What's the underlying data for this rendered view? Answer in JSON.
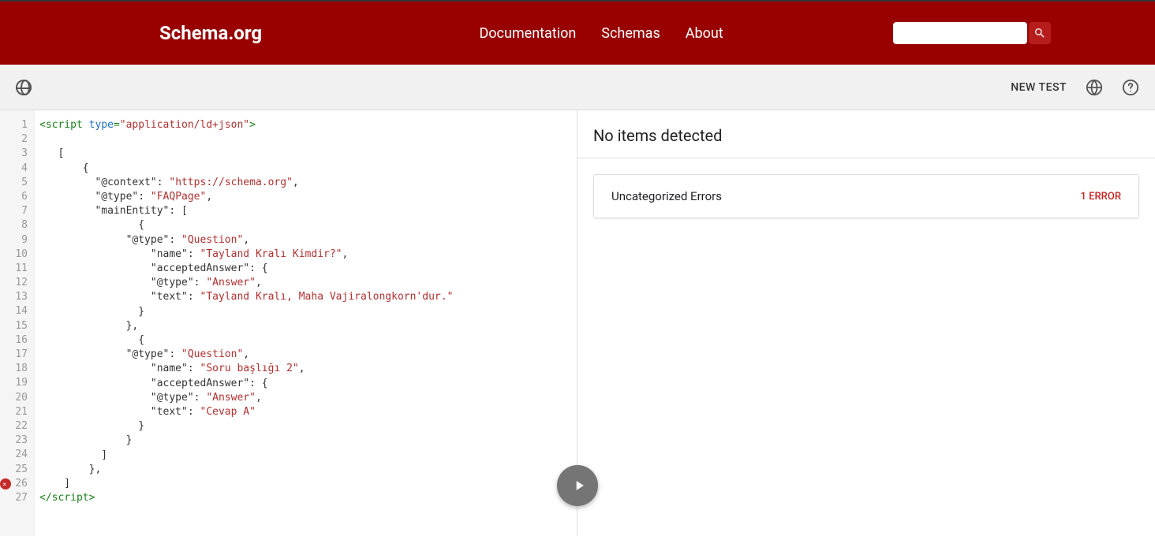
{
  "header": {
    "logo": "Schema.org",
    "nav": {
      "documentation": "Documentation",
      "schemas": "Schemas",
      "about": "About"
    }
  },
  "toolbar": {
    "newTest": "NEW TEST"
  },
  "editor": {
    "errorLine": 26,
    "lines": [
      {
        "n": 1,
        "tokens": [
          [
            "tag",
            "<script "
          ],
          [
            "attr",
            "type"
          ],
          [
            "tag",
            "="
          ],
          [
            "str",
            "\"application/ld+json\""
          ],
          [
            "tag",
            ">"
          ]
        ]
      },
      {
        "n": 2,
        "tokens": []
      },
      {
        "n": 3,
        "tokens": [
          [
            "key",
            "   ["
          ]
        ]
      },
      {
        "n": 4,
        "tokens": [
          [
            "key",
            "       {"
          ]
        ]
      },
      {
        "n": 5,
        "tokens": [
          [
            "key",
            "         \"@context\": "
          ],
          [
            "str",
            "\"https://schema.org\""
          ],
          [
            "key",
            ","
          ]
        ]
      },
      {
        "n": 6,
        "tokens": [
          [
            "key",
            "         \"@type\": "
          ],
          [
            "str",
            "\"FAQPage\""
          ],
          [
            "key",
            ","
          ]
        ]
      },
      {
        "n": 7,
        "tokens": [
          [
            "key",
            "         \"mainEntity\": ["
          ]
        ]
      },
      {
        "n": 8,
        "tokens": [
          [
            "key",
            "                {"
          ]
        ]
      },
      {
        "n": 9,
        "tokens": [
          [
            "key",
            "              \"@type\": "
          ],
          [
            "str",
            "\"Question\""
          ],
          [
            "key",
            ","
          ]
        ]
      },
      {
        "n": 10,
        "tokens": [
          [
            "key",
            "                  \"name\": "
          ],
          [
            "str",
            "\"Tayland Kralı Kimdir?\""
          ],
          [
            "key",
            ","
          ]
        ]
      },
      {
        "n": 11,
        "tokens": [
          [
            "key",
            "                  \"acceptedAnswer\": {"
          ]
        ]
      },
      {
        "n": 12,
        "tokens": [
          [
            "key",
            "                  \"@type\": "
          ],
          [
            "str",
            "\"Answer\""
          ],
          [
            "key",
            ","
          ]
        ]
      },
      {
        "n": 13,
        "tokens": [
          [
            "key",
            "                  \"text\": "
          ],
          [
            "str",
            "\"Tayland Kralı, Maha Vajiralongkorn'dur.\""
          ]
        ]
      },
      {
        "n": 14,
        "tokens": [
          [
            "key",
            "                }"
          ]
        ]
      },
      {
        "n": 15,
        "tokens": [
          [
            "key",
            "              },"
          ]
        ]
      },
      {
        "n": 16,
        "tokens": [
          [
            "key",
            "                {"
          ]
        ]
      },
      {
        "n": 17,
        "tokens": [
          [
            "key",
            "              \"@type\": "
          ],
          [
            "str",
            "\"Question\""
          ],
          [
            "key",
            ","
          ]
        ]
      },
      {
        "n": 18,
        "tokens": [
          [
            "key",
            "                  \"name\": "
          ],
          [
            "str",
            "\"Soru başlığı 2\""
          ],
          [
            "key",
            ","
          ]
        ]
      },
      {
        "n": 19,
        "tokens": [
          [
            "key",
            "                  \"acceptedAnswer\": {"
          ]
        ]
      },
      {
        "n": 20,
        "tokens": [
          [
            "key",
            "                  \"@type\": "
          ],
          [
            "str",
            "\"Answer\""
          ],
          [
            "key",
            ","
          ]
        ]
      },
      {
        "n": 21,
        "tokens": [
          [
            "key",
            "                  \"text\": "
          ],
          [
            "str",
            "\"Cevap A\""
          ]
        ]
      },
      {
        "n": 22,
        "tokens": [
          [
            "key",
            "                }"
          ]
        ]
      },
      {
        "n": 23,
        "tokens": [
          [
            "key",
            "              }"
          ]
        ]
      },
      {
        "n": 24,
        "tokens": [
          [
            "key",
            "          ]"
          ]
        ]
      },
      {
        "n": 25,
        "tokens": [
          [
            "key",
            "        }, "
          ]
        ]
      },
      {
        "n": 26,
        "tokens": [
          [
            "key",
            "    ]"
          ]
        ]
      },
      {
        "n": 27,
        "tokens": [
          [
            "tag",
            "</script"
          ],
          [
            "tag",
            ">"
          ]
        ]
      }
    ]
  },
  "results": {
    "heading": "No items detected",
    "card": {
      "title": "Uncategorized Errors",
      "error": "1 ERROR"
    }
  }
}
